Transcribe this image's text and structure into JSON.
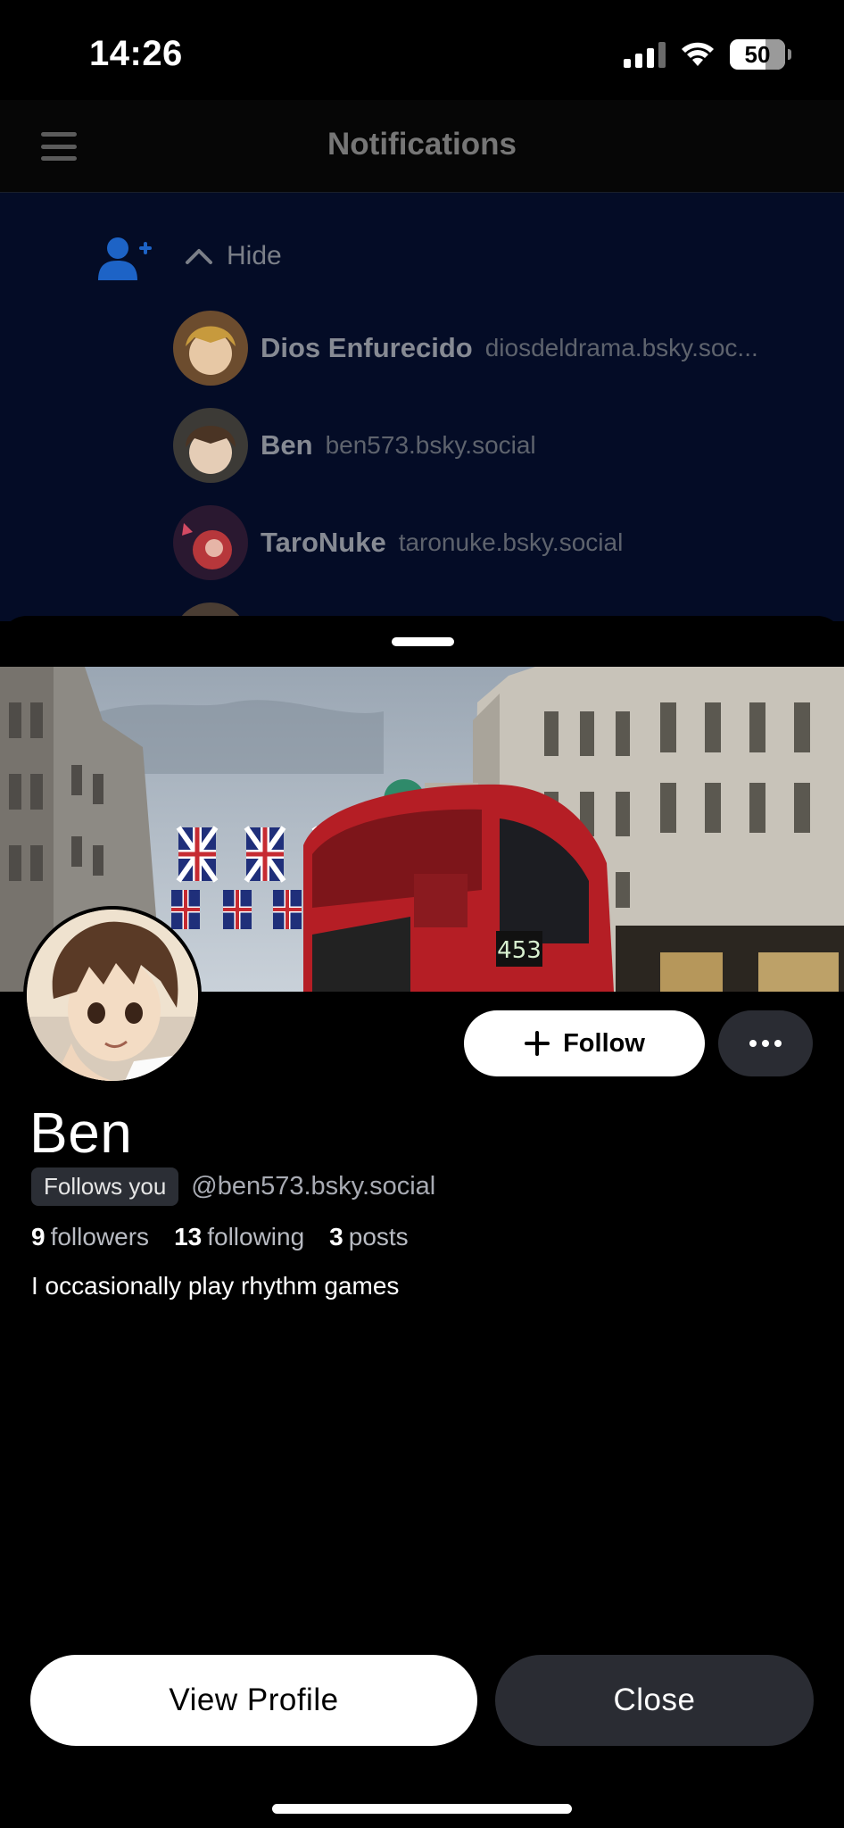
{
  "status_bar": {
    "time": "14:26",
    "battery": "50"
  },
  "header": {
    "title": "Notifications"
  },
  "notifications": {
    "hide_label": "Hide",
    "rows": [
      {
        "name": "Dios Enfurecido",
        "handle": "diosdeldrama.bsky.soc..."
      },
      {
        "name": "Ben",
        "handle": "ben573.bsky.social"
      },
      {
        "name": "TaroNuke",
        "handle": "taronuke.bsky.social"
      }
    ]
  },
  "profile": {
    "banner_bus_number": "453",
    "display_name": "Ben",
    "follows_you_badge": "Follows you",
    "handle": "@ben573.bsky.social",
    "stats": {
      "followers_count": "9",
      "followers_label": "followers",
      "following_count": "13",
      "following_label": "following",
      "posts_count": "3",
      "posts_label": "posts"
    },
    "bio": "I occasionally play rhythm games",
    "follow_label": "Follow"
  },
  "actions": {
    "view_profile": "View Profile",
    "close": "Close"
  },
  "colors": {
    "accent_blue": "#1d63c6",
    "notif_bg": "#040c26",
    "button_dark": "#2a2c33"
  }
}
